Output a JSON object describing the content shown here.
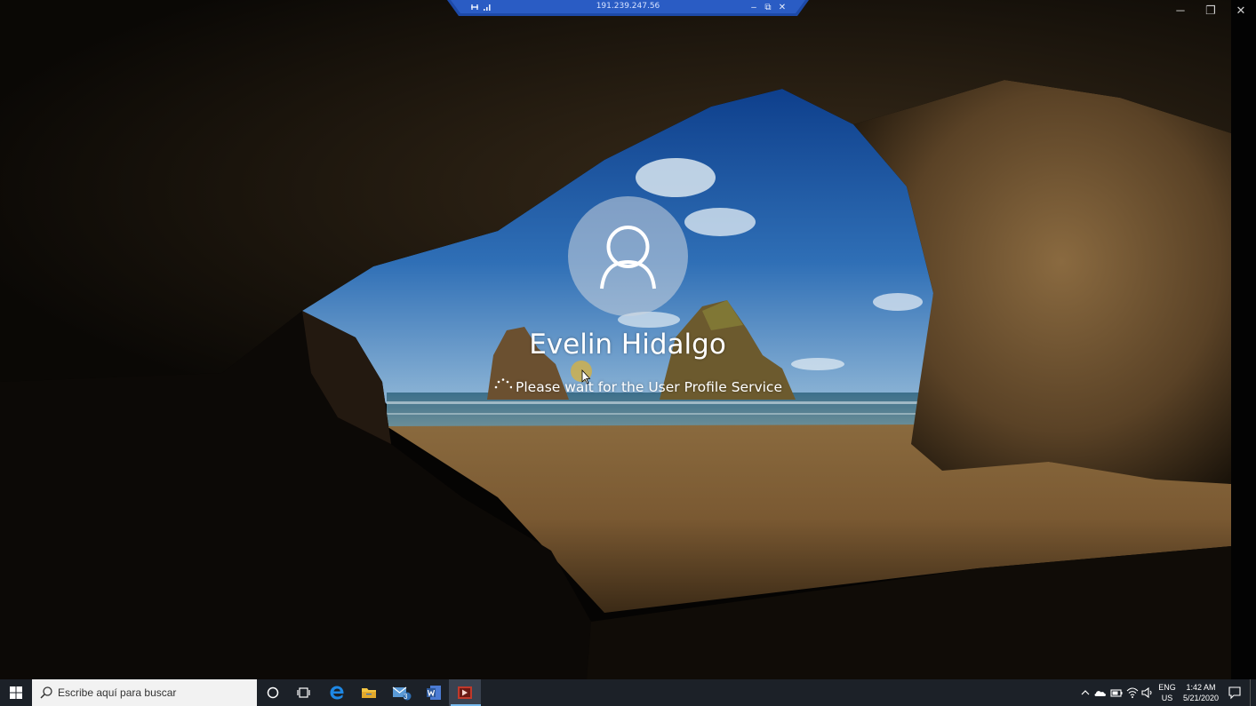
{
  "rdp_bar": {
    "host_ip": "191.239.247.56",
    "pin_icon": "pin-icon",
    "signal_icon": "connection-signal-icon",
    "minimize_label": "–",
    "restore_label": "⧉",
    "close_label": "✕"
  },
  "window_controls": {
    "minimize_label": "─",
    "restore_label": "❐",
    "close_label": "✕"
  },
  "login": {
    "user_name": "Evelin Hidalgo",
    "status_message": "Please wait for the User Profile Service",
    "avatar_icon": "user-avatar-icon",
    "spinner_icon": "loading-spinner-icon"
  },
  "taskbar": {
    "search_placeholder": "Escribe aquí para buscar",
    "pinned_apps": [
      "start-windows-icon",
      "cortana-circle-icon",
      "task-view-icon",
      "edge-browser-icon",
      "file-explorer-icon",
      "outlook-mail-icon",
      "word-icon",
      "remote-desktop-icon"
    ],
    "mail_badge": "3",
    "tray": {
      "language_line1": "ENG",
      "language_line2": "US",
      "time": "1:42 AM",
      "date": "5/21/2020"
    }
  },
  "colors": {
    "taskbar_bg": "#1c2128",
    "rdp_bar": "#1d4aa8",
    "accent": "#76b9ed"
  }
}
